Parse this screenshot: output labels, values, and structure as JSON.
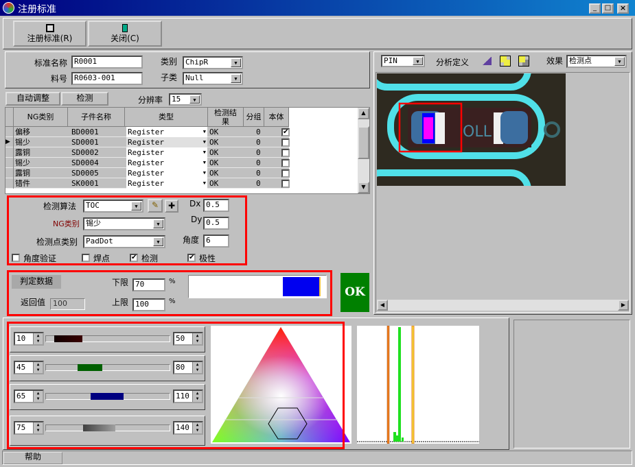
{
  "window": {
    "title": "注册标准",
    "controls": [
      "_",
      "□",
      "×"
    ]
  },
  "toolbar": {
    "register_label": "注册标准(R)",
    "close_label": "关闭(C)"
  },
  "info": {
    "std_name_label": "标准名称",
    "std_name_value": "R0001",
    "part_no_label": "料号",
    "part_no_value": "R0603-001",
    "category_label": "类别",
    "category_value": "ChipR",
    "subcategory_label": "子类",
    "subcategory_value": "Null"
  },
  "tabs": {
    "auto_adjust": "自动调整",
    "detect": "检测",
    "resolution_label": "分辨率",
    "resolution_value": "15"
  },
  "grid": {
    "headers": [
      "NG类别",
      "子件名称",
      "类型",
      "检测结果",
      "分组",
      "本体"
    ],
    "rows": [
      {
        "ng": "偏移",
        "name": "BD0001",
        "type": "Register",
        "result": "OK",
        "group": "0",
        "body": true
      },
      {
        "ng": "锡少",
        "name": "SD0001",
        "type": "Register",
        "result": "OK",
        "group": "0",
        "body": false
      },
      {
        "ng": "露铜",
        "name": "SD0002",
        "type": "Register",
        "result": "OK",
        "group": "0",
        "body": false
      },
      {
        "ng": "锡少",
        "name": "SD0004",
        "type": "Register",
        "result": "OK",
        "group": "0",
        "body": false
      },
      {
        "ng": "露铜",
        "name": "SD0005",
        "type": "Register",
        "result": "OK",
        "group": "0",
        "body": false
      },
      {
        "ng": "错件",
        "name": "SK0001",
        "type": "Register",
        "result": "OK",
        "group": "0",
        "body": false
      }
    ],
    "selected_row": 1
  },
  "algo": {
    "algo_label": "检测算法",
    "algo_value": "TOC",
    "ng_label": "NG类别",
    "ng_value": "锡少",
    "point_label": "检测点类别",
    "point_value": "PadDot",
    "dx_label": "Dx",
    "dx_value": "0.5",
    "dy_label": "Dy",
    "dy_value": "0.5",
    "angle_label": "角度",
    "angle_value": "6",
    "checks": [
      {
        "label": "角度验证",
        "checked": false
      },
      {
        "label": "焊点",
        "checked": false
      },
      {
        "label": "检测",
        "checked": true
      },
      {
        "label": "极性",
        "checked": true
      }
    ]
  },
  "judge": {
    "title": "判定数据",
    "lower_label": "下限",
    "lower_value": "70",
    "upper_label": "上限",
    "upper_value": "100",
    "unit": "%",
    "return_label": "返回值",
    "return_value": "100",
    "result": "OK",
    "result_color": "#008000",
    "bar_fill_percent": 70
  },
  "view": {
    "pin_value": "PIN",
    "analysis_label": "分析定义",
    "effect_label": "效果",
    "effect_value": "检测点"
  },
  "sliders": [
    {
      "min": "10",
      "max": "50",
      "color": "#3a0000"
    },
    {
      "min": "45",
      "max": "80",
      "color": "#006000"
    },
    {
      "min": "65",
      "max": "110",
      "color": "#000080"
    },
    {
      "min": "75",
      "max": "140",
      "color": "#707070"
    }
  ],
  "status": {
    "help_label": "帮助"
  }
}
